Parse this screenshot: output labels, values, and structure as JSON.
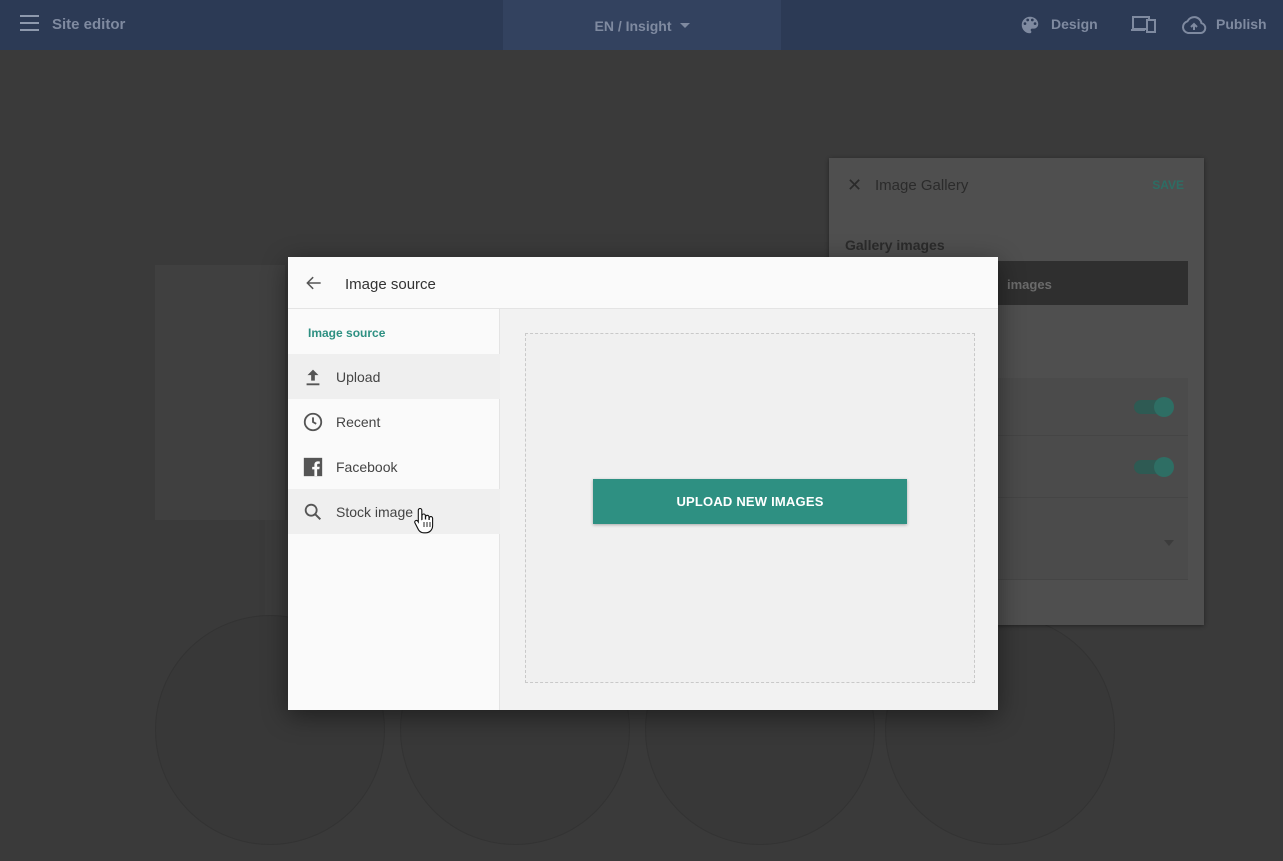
{
  "topbar": {
    "app_title": "Site editor",
    "page_selector": "EN / Insight",
    "design_label": "Design",
    "publish_label": "Publish",
    "menu_icon": "hamburger-icon",
    "design_icon": "palette-icon",
    "devices_icon": "devices-icon",
    "publish_icon": "cloud-upload-icon"
  },
  "side_panel": {
    "title": "Image Gallery",
    "save_label": "SAVE",
    "section_label": "Gallery images",
    "bar_label": "images"
  },
  "modal": {
    "title": "Image source",
    "sidebar_heading": "Image source",
    "items": [
      {
        "label": "Upload",
        "icon": "upload-icon"
      },
      {
        "label": "Recent",
        "icon": "clock-icon"
      },
      {
        "label": "Facebook",
        "icon": "facebook-icon"
      },
      {
        "label": "Stock image",
        "icon": "search-icon"
      }
    ],
    "upload_button_label": "UPLOAD NEW IMAGES"
  },
  "colors": {
    "accent": "#2e9082",
    "topbar": "#2c3a55"
  }
}
